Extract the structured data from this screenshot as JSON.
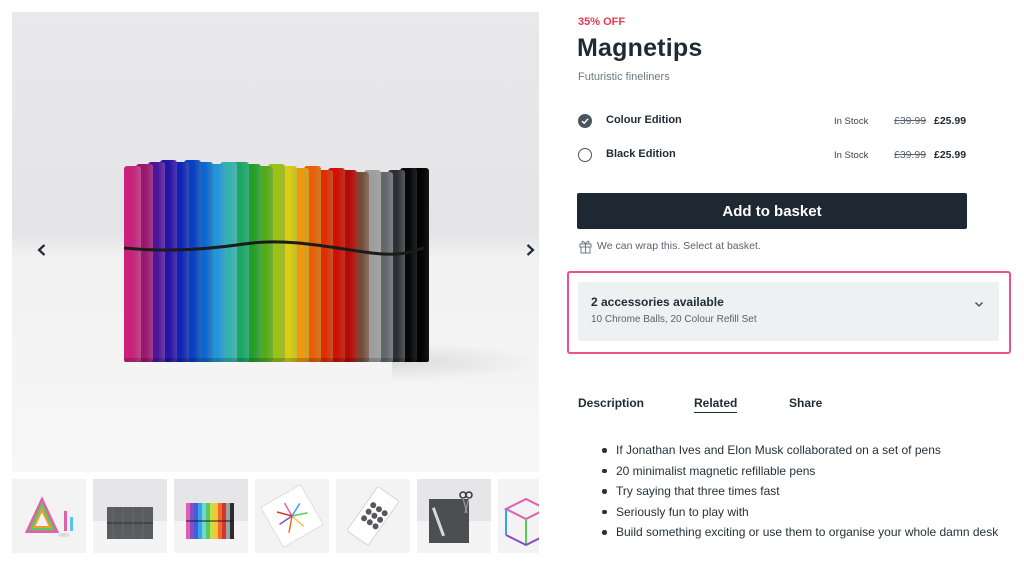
{
  "gallery": {
    "prev_icon": "chevron-left-icon",
    "next_icon": "chevron-right-icon",
    "pen_colors": [
      "#e25fb0",
      "#c64ca9",
      "#8a4bc8",
      "#6147cf",
      "#3f5fd8",
      "#2f7ee0",
      "#3aa2e8",
      "#56c4ec",
      "#6ed6d4",
      "#4fcf9f",
      "#5cc95f",
      "#8fd24a",
      "#c6df44",
      "#ece640",
      "#f8c53a",
      "#f59a2f",
      "#f06a2a",
      "#e6412a",
      "#d5372f",
      "#a98a78",
      "#c9c9c9",
      "#9ea2a5",
      "#6b6f73",
      "#2b2c2e",
      "#1a1a1b"
    ],
    "thumbnails": [
      "Triangle of pens",
      "Grey pen set",
      "Colour pen set",
      "Colour chart card",
      "Chrome balls pack",
      "Pens with scissors",
      "Pen structure"
    ]
  },
  "product": {
    "discount": "35% OFF",
    "title": "Magnetips",
    "subtitle": "Futuristic fineliners",
    "variants": [
      {
        "name": "Colour Edition",
        "stock": "In Stock",
        "was_price": "£39.99",
        "price": "£25.99",
        "selected": true
      },
      {
        "name": "Black Edition",
        "stock": "In Stock",
        "was_price": "£39.99",
        "price": "£25.99",
        "selected": false
      }
    ],
    "add_to_basket": "Add to basket",
    "gift_icon": "gift-icon",
    "wrap_note": "We can wrap this. Select at basket."
  },
  "accessories": {
    "title": "2 accessories available",
    "list": "10 Chrome Balls, 20 Colour Refill Set",
    "highlight_color": "#ef4f91"
  },
  "tabs": [
    {
      "label": "Description",
      "active": false
    },
    {
      "label": "Related",
      "active": true
    },
    {
      "label": "Share",
      "active": false
    }
  ],
  "description": [
    "If Jonathan Ives and Elon Musk collaborated on a set of pens",
    "20 minimalist magnetic refillable pens",
    "Try saying that three times fast",
    "Seriously fun to play with",
    "Build something exciting or use them to organise your whole damn desk"
  ]
}
